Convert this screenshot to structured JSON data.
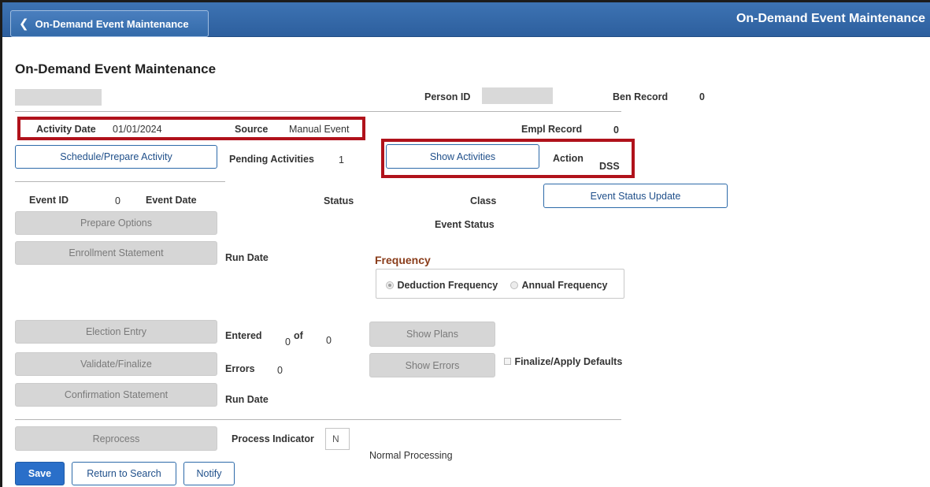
{
  "header": {
    "back_label": "On-Demand Event Maintenance",
    "title": "On-Demand Event Maintenance"
  },
  "page": {
    "title": "On-Demand Event Maintenance"
  },
  "person": {
    "person_id_label": "Person ID",
    "ben_record_label": "Ben Record",
    "ben_record_value": "0",
    "empl_record_label": "Empl Record",
    "empl_record_value": "0"
  },
  "activity": {
    "date_label": "Activity Date",
    "date_value": "01/01/2024",
    "source_label": "Source",
    "source_value": "Manual Event",
    "schedule_button": "Schedule/Prepare Activity",
    "pending_label": "Pending Activities",
    "pending_value": "1",
    "show_activities_button": "Show Activities",
    "action_label": "Action",
    "action_value": "DSS"
  },
  "event": {
    "event_id_label": "Event ID",
    "event_id_value": "0",
    "event_date_label": "Event Date",
    "status_label": "Status",
    "class_label": "Class",
    "status_update_button": "Event Status Update",
    "prepare_options_button": "Prepare Options",
    "event_status_label": "Event Status",
    "enrollment_statement_button": "Enrollment Statement",
    "run_date_label": "Run Date"
  },
  "frequency": {
    "title": "Frequency",
    "options": [
      "Deduction Frequency",
      "Annual Frequency"
    ],
    "selected": "Deduction Frequency"
  },
  "election": {
    "election_entry_button": "Election Entry",
    "entered_label": "Entered",
    "entered_value": "0",
    "of_label": "of",
    "of_value": "0",
    "show_plans_button": "Show Plans",
    "validate_button": "Validate/Finalize",
    "errors_label": "Errors",
    "errors_value": "0",
    "show_errors_button": "Show Errors",
    "finalize_defaults_label": "Finalize/Apply Defaults",
    "confirmation_button": "Confirmation Statement",
    "run_date_label": "Run Date"
  },
  "processing": {
    "reprocess_button": "Reprocess",
    "indicator_label": "Process Indicator",
    "indicator_value": "N",
    "indicator_desc": "Normal Processing"
  },
  "footer": {
    "save": "Save",
    "return_to_search": "Return to Search",
    "notify": "Notify"
  },
  "colors": {
    "banner": "#336aa9",
    "highlight": "#b0121b",
    "primary_button": "#2a6fc9",
    "frequency_title": "#8a3d1b"
  }
}
